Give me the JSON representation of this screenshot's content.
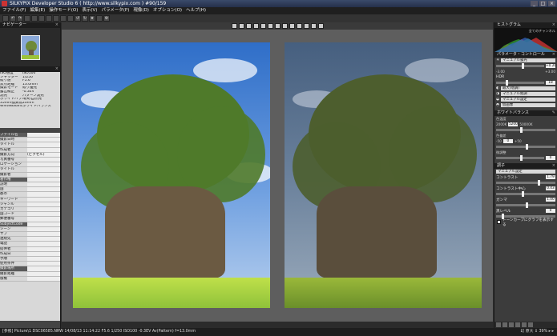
{
  "window": {
    "title": "SILKYPIX Developer Studio 6 ( http://www.silkypix.com )    #90/159"
  },
  "menu": [
    "ファイル(F)",
    "編集(E)",
    "操作モード(O)",
    "表示(V)",
    "パラメータ(P)",
    "現像(D)",
    "オプション(O)",
    "ヘルプ(H)"
  ],
  "navigator": {
    "title": "ナビゲーター"
  },
  "exif": [
    [
      "ISO感度",
      "ISO100"
    ],
    [
      "シャッター",
      "1/250"
    ],
    [
      "絞り値",
      "F5.6"
    ],
    [
      "焦点距離",
      "13.0mm"
    ],
    [
      "撮影モード",
      "絞り優先"
    ],
    [
      "露出補正",
      "-0.3EV"
    ],
    [
      "測光",
      "パターン測光"
    ],
    [
      "ホワイトバランス",
      "晴天/自然光"
    ],
    [
      "35mm換算焦点距離",
      "20mm"
    ],
    [
      "WhiteBalance",
      "ホワイトバランス"
    ]
  ],
  "metadata": [
    [
      "ファイル名",
      "GPS"
    ],
    [
      "撮影日時",
      ""
    ],
    [
      "タイトル",
      ""
    ],
    [
      "作成者",
      ""
    ],
    [
      "撮影方向",
      "(ピクセル)"
    ],
    [
      "写真番号",
      ""
    ],
    [
      "ロケーション",
      ""
    ],
    [
      "タイトル",
      ""
    ],
    [
      "撮影者",
      ""
    ],
    [
      "著作権",
      ""
    ],
    [
      "説明",
      ""
    ],
    [
      "国",
      ""
    ],
    [
      "都市",
      ""
    ],
    [
      "キーワード",
      ""
    ],
    [
      "ジャンル",
      ""
    ],
    [
      "カテゴリ",
      ""
    ],
    [
      "国コード",
      ""
    ],
    [
      "郵便番号",
      ""
    ],
    [
      "SubjectCode",
      ""
    ],
    [
      "シーン",
      ""
    ],
    [
      "サブ",
      ""
    ],
    [
      "連絡先",
      ""
    ],
    [
      "電話",
      ""
    ],
    [
      "提供者",
      ""
    ],
    [
      "作成日",
      ""
    ],
    [
      "手順",
      ""
    ],
    [
      "使用条件",
      ""
    ],
    [
      "撮影場所",
      ""
    ],
    [
      "撮影距離",
      ""
    ],
    [
      "版権",
      ""
    ]
  ],
  "center_toolbar_count": 13,
  "statusbar": {
    "text": "[参照] Picture\\1 DSC06585.NRW 14/08/13 11:14:22 F5.6 1/250 ISO100 -0.3EV Av(Pattern) f=13.0mm",
    "right": "幻 原大 ↕ 39% ▸ ▸"
  },
  "histogram": {
    "title": "ヒストグラム",
    "mode": "全てのチャンネル"
  },
  "param": {
    "title": "パラメータ・コントロール",
    "exposure_mode": "マニュアル露光",
    "exposure_value": "+0.20",
    "exposure_min": "-3.00",
    "exposure_max": "+3.00",
    "hdr_label": "HDR",
    "hdr_value": "18",
    "presets": [
      "最大(階調)",
      "マニュアル階調",
      "マニュアル設定",
      "仮画像"
    ],
    "wb_title": "ホワイトバランス",
    "color_temp_label": "色温度",
    "color_temp_value": "5200",
    "color_temp_min": "2000K",
    "color_temp_max": "50000K",
    "tint_label": "色偏差",
    "tint_value": "0",
    "tint_min": "-50",
    "tint_max": "+50",
    "color_level_label": "微調整",
    "color_level_value": "0",
    "tone_title": "調子",
    "tone_mode": "マニュアル設定",
    "contrast_label": "コントラスト",
    "contrast_value": "1.79",
    "contrast_center_label": "コントラスト中心",
    "contrast_center_value": "0.43",
    "gamma_label": "ガンマ",
    "gamma_value": "1.00",
    "black_label": "黒レベル",
    "black_value": "0",
    "tonecurve_label": "トーンカーブにグラフを表示する"
  }
}
